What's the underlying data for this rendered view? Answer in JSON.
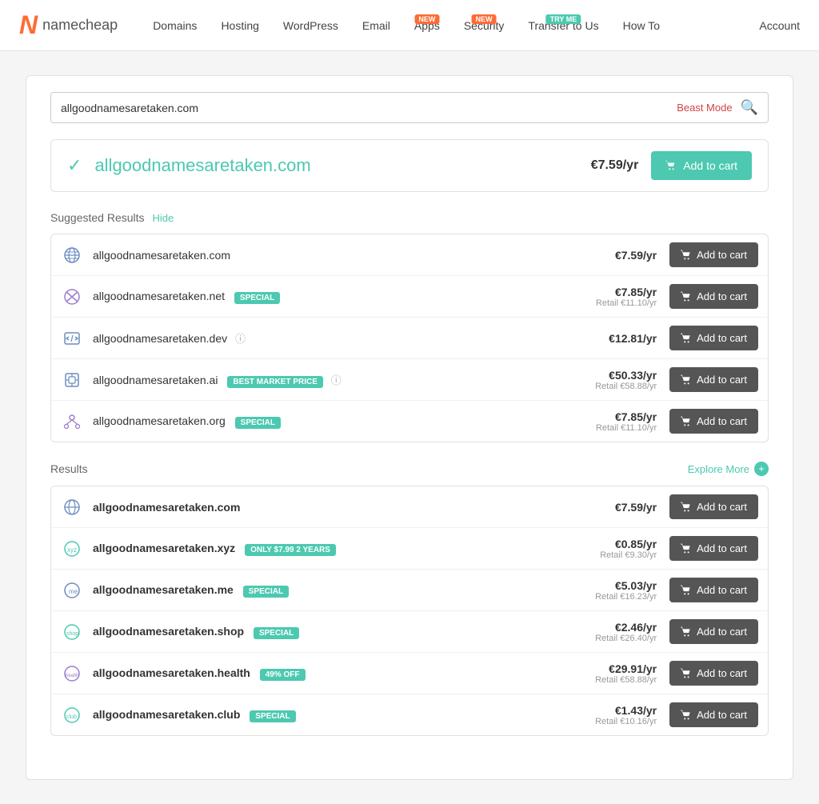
{
  "nav": {
    "logo_n": "N",
    "logo_text": "namecheap",
    "items": [
      {
        "label": "Domains",
        "badge": null
      },
      {
        "label": "Hosting",
        "badge": null
      },
      {
        "label": "WordPress",
        "badge": null
      },
      {
        "label": "Email",
        "badge": null
      },
      {
        "label": "Apps",
        "badge": "NEW"
      },
      {
        "label": "Security",
        "badge": "NEW"
      },
      {
        "label": "Transfer to Us",
        "badge": "TRY ME"
      },
      {
        "label": "How To",
        "badge": null
      }
    ],
    "account": "Account"
  },
  "search": {
    "value": "allgoodnamesaretaken.com",
    "beast_mode": "Beast Mode"
  },
  "primary": {
    "domain": "allgoodnamesaretaken.com",
    "price": "€7.59/yr",
    "add_label": "Add to cart"
  },
  "suggested": {
    "title": "Suggested Results",
    "hide": "Hide",
    "items": [
      {
        "domain": "allgoodnamesaretaken.com",
        "tld": "com",
        "price": "€7.59/yr",
        "retail": null,
        "tag": null,
        "info": false
      },
      {
        "domain": "allgoodnamesaretaken.net",
        "tld": "net",
        "price": "€7.85/yr",
        "retail": "Retail €11.10/yr",
        "tag": "SPECIAL",
        "tag_type": "special",
        "info": false
      },
      {
        "domain": "allgoodnamesaretaken.dev",
        "tld": "dev",
        "price": "€12.81/yr",
        "retail": null,
        "tag": null,
        "info": true
      },
      {
        "domain": "allgoodnamesaretaken.ai",
        "tld": "ai",
        "price": "€50.33/yr",
        "retail": "Retail €58.88/yr",
        "tag": "BEST MARKET PRICE",
        "tag_type": "bmp",
        "info": true
      },
      {
        "domain": "allgoodnamesaretaken.org",
        "tld": "org",
        "price": "€7.85/yr",
        "retail": "Retail €11.10/yr",
        "tag": "SPECIAL",
        "tag_type": "special",
        "info": false
      }
    ],
    "add_label": "Add to cart"
  },
  "results": {
    "title": "Results",
    "explore_more": "Explore More",
    "items": [
      {
        "domain": "allgoodnamesaretaken.com",
        "tld": "com",
        "price": "€7.59/yr",
        "retail": null,
        "tag": null,
        "tag_type": null,
        "info": false
      },
      {
        "domain": "allgoodnamesaretaken.xyz",
        "tld": "xyz",
        "price": "€0.85/yr",
        "retail": "Retail €9.30/yr",
        "tag": "ONLY $7.99 2 YEARS",
        "tag_type": "only",
        "info": false
      },
      {
        "domain": "allgoodnamesaretaken.me",
        "tld": "me",
        "price": "€5.03/yr",
        "retail": "Retail €16.23/yr",
        "tag": "SPECIAL",
        "tag_type": "special",
        "info": false
      },
      {
        "domain": "allgoodnamesaretaken.shop",
        "tld": "shop",
        "price": "€2.46/yr",
        "retail": "Retail €26.40/yr",
        "tag": "SPECIAL",
        "tag_type": "special",
        "info": false
      },
      {
        "domain": "allgoodnamesaretaken.health",
        "tld": "health",
        "price": "€29.91/yr",
        "retail": "Retail €58.88/yr",
        "tag": "49% OFF",
        "tag_type": "off",
        "info": false
      },
      {
        "domain": "allgoodnamesaretaken.club",
        "tld": "club",
        "price": "€1.43/yr",
        "retail": "Retail €10.16/yr",
        "tag": "SPECIAL",
        "tag_type": "special",
        "info": false
      }
    ],
    "add_label": "Add to cart"
  }
}
